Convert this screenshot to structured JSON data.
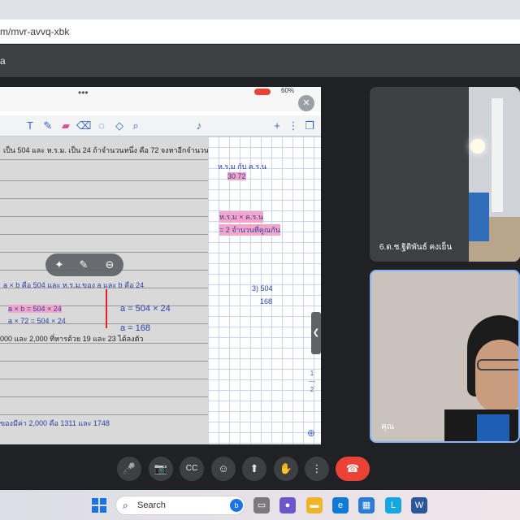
{
  "browser": {
    "url": "m/mvr-avvq-xbk"
  },
  "meet": {
    "title": "a",
    "participants": [
      {
        "name": "6.ด.ช.ฐิติพันธ์ คงเย็น"
      },
      {
        "name": "คุณ"
      }
    ]
  },
  "presentation": {
    "top_dots": "•••",
    "battery": "60%",
    "page_numbers": [
      "1",
      "2"
    ],
    "problem_line": "เป็น 504 และ ห.ร.ม. เป็น 24 ถ้าจำนวนหนึ่ง คือ 72 จงหาอีกจำนวนหนึ่ง",
    "hand_lines": [
      "a × b   คือ 504   และ ห.ร.ม.ของ a และ b คือ 24",
      "a × b = 504 × 24",
      "a × 72 = 504 × 24",
      "a = 504 × 24",
      "a = 168",
      "000 และ 2,000 ที่หารด้วย 19 และ 23 ได้ลงตัว",
      "ของมีค่า 2,000 คือ 1311 และ 1748"
    ],
    "grid_notes": [
      "ห.ร.ม   กับ   ค.ร.น",
      "30    72",
      "ห.ร.ม × ค.ร.น",
      "= 2 จำนวนที่คูณกัน",
      "3) 504",
      "168"
    ]
  },
  "controls": {
    "mic": "🎤",
    "camera": "📷",
    "captions": "CC",
    "emoji": "☺",
    "present": "⬆",
    "hand": "✋",
    "more": "⋮",
    "end": "☎"
  },
  "taskbar": {
    "search_label": "Search"
  }
}
